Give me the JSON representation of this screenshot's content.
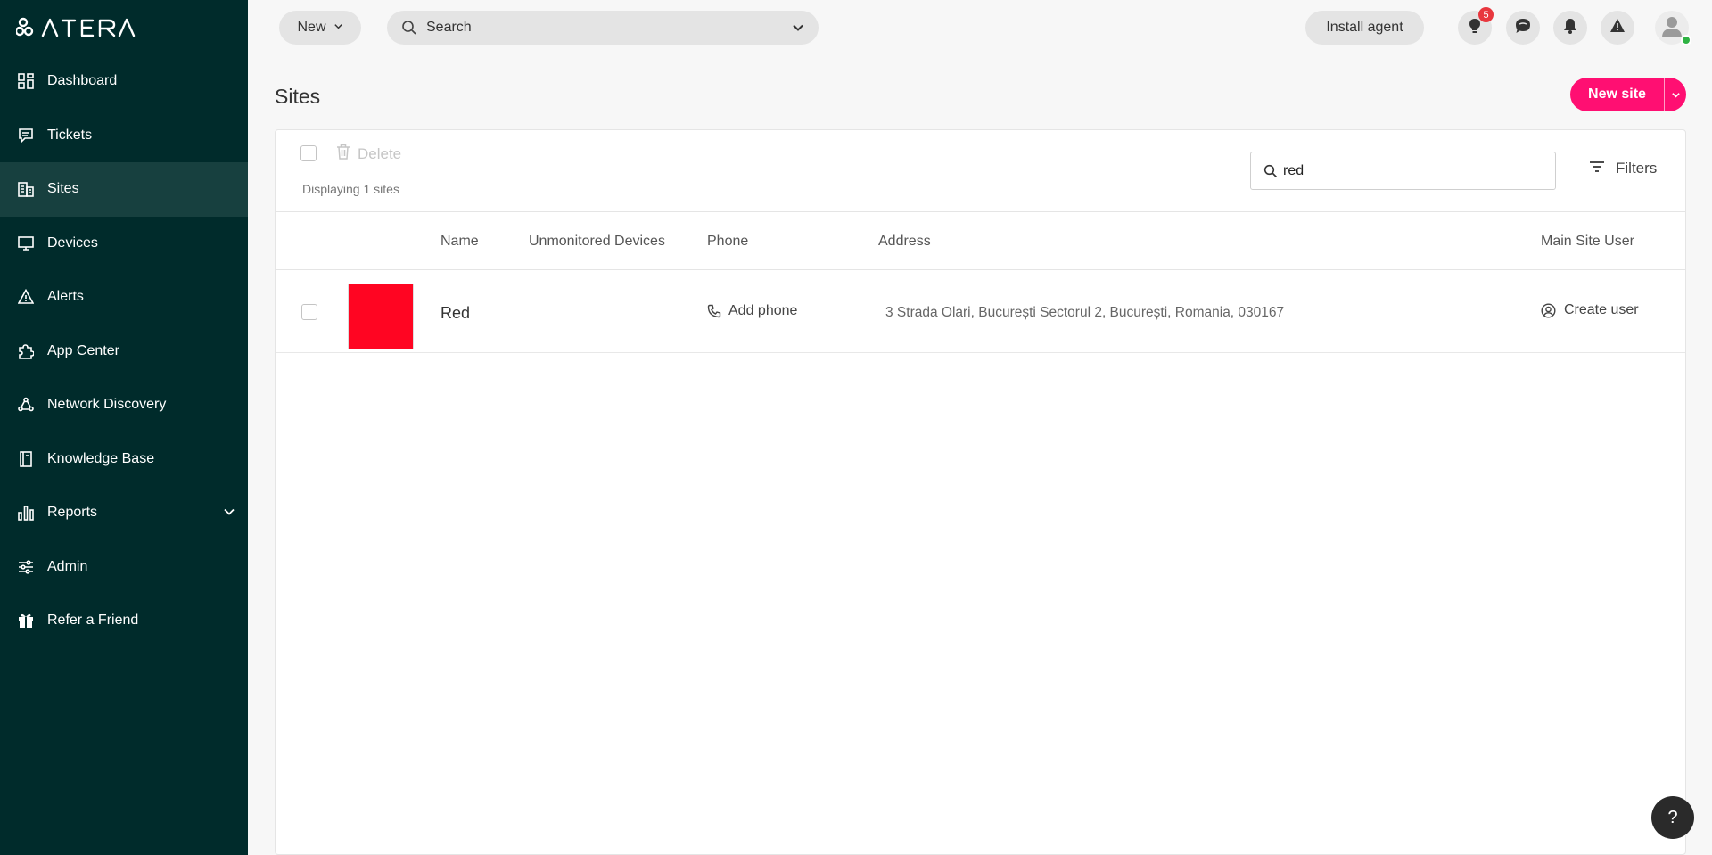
{
  "brand": {
    "logo_text": "ATERA",
    "accent": "#ff0f72",
    "sidebar_bg": "#002b2b"
  },
  "sidebar": {
    "items": [
      {
        "label": "Dashboard",
        "icon": "dashboard-icon"
      },
      {
        "label": "Tickets",
        "icon": "ticket-icon"
      },
      {
        "label": "Sites",
        "icon": "building-icon",
        "active": true
      },
      {
        "label": "Devices",
        "icon": "monitor-icon"
      },
      {
        "label": "Alerts",
        "icon": "warning-icon"
      },
      {
        "label": "App Center",
        "icon": "puzzle-icon"
      },
      {
        "label": "Network Discovery",
        "icon": "network-icon"
      },
      {
        "label": "Knowledge Base",
        "icon": "book-icon"
      },
      {
        "label": "Reports",
        "icon": "bar-chart-icon"
      },
      {
        "label": "Admin",
        "icon": "sliders-icon"
      },
      {
        "label": "Refer a Friend",
        "icon": "gift-icon"
      }
    ]
  },
  "topbar": {
    "new_label": "New",
    "search_placeholder": "Search",
    "install_label": "Install agent",
    "ideas_badge": "5"
  },
  "page": {
    "title": "Sites",
    "new_site_label": "New site"
  },
  "toolbar": {
    "delete_label": "Delete",
    "displaying": "Displaying 1 sites",
    "filter_value": "red",
    "filters_label": "Filters"
  },
  "table": {
    "headers": [
      "Name",
      "Unmonitored Devices",
      "Phone",
      "Address",
      "Main Site User"
    ],
    "rows": [
      {
        "name": "Red",
        "thumb_color": "#ff0522",
        "phone": "Add phone",
        "address": "3 Strada Olari, București Sectorul 2, București, Romania, 030167",
        "user": "Create user"
      }
    ]
  },
  "help_label": "?"
}
